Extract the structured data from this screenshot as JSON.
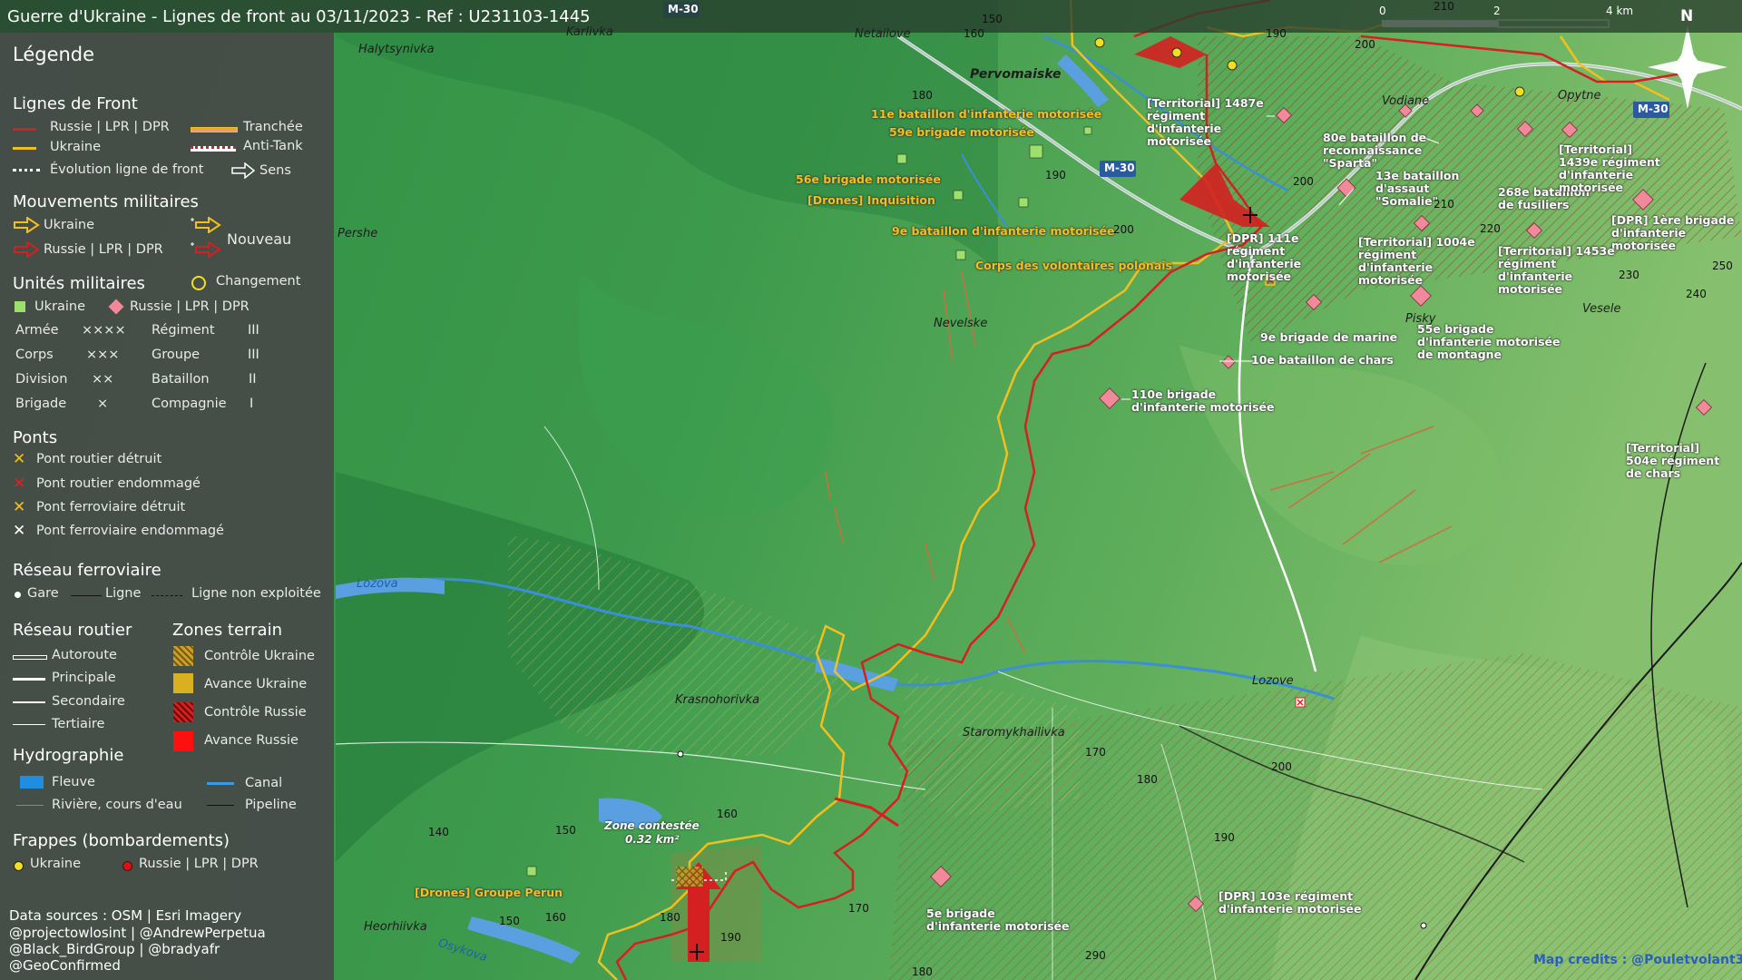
{
  "title": "Guerre d'Ukraine - Lignes de front au 03/11/2023 - Ref : U231103-1445",
  "scale": {
    "label0": "0",
    "label2": "2",
    "label4": "4 km"
  },
  "north": "N",
  "roads": {
    "m30_a": "M-30",
    "m30_b": "M-30",
    "m30_c": "M-30"
  },
  "legend": {
    "title": "Légende",
    "front_lines": {
      "title": "Lignes de Front",
      "russia": "Russie | LPR | DPR",
      "ukraine": "Ukraine",
      "trench": "Tranchée",
      "antitank": "Anti-Tank",
      "evolution": "Évolution ligne de front",
      "direction": "Sens"
    },
    "movements": {
      "title": "Mouvements militaires",
      "ukraine": "Ukraine",
      "russia": "Russie | LPR | DPR",
      "new": "Nouveau"
    },
    "units": {
      "title": "Unités militaires",
      "change": "Changement",
      "ukraine": "Ukraine",
      "russia": "Russie | LPR | DPR",
      "rows": [
        {
          "left": "Armée",
          "left_sym": "××××",
          "right": "Régiment",
          "right_sym": "III"
        },
        {
          "left": "Corps",
          "left_sym": "×××",
          "right": "Groupe",
          "right_sym": "III"
        },
        {
          "left": "Division",
          "left_sym": "××",
          "right": "Bataillon",
          "right_sym": "II"
        },
        {
          "left": "Brigade",
          "left_sym": "×",
          "right": "Compagnie",
          "right_sym": "I"
        }
      ]
    },
    "bridges": {
      "title": "Ponts",
      "items": [
        "Pont routier détruit",
        "Pont routier endommagé",
        "Pont ferroviaire détruit",
        "Pont ferroviaire endommagé"
      ],
      "colors": [
        "#f2c01e",
        "#e02020",
        "#f2c01e",
        "#ffffff"
      ]
    },
    "rail": {
      "title": "Réseau ferroviaire",
      "station": "Gare",
      "line": "Ligne",
      "unused": "Ligne non exploitée"
    },
    "road": {
      "title": "Réseau routier",
      "items": [
        "Autoroute",
        "Principale",
        "Secondaire",
        "Tertiaire"
      ]
    },
    "zones": {
      "title": "Zones terrain",
      "items": [
        "Contrôle Ukraine",
        "Avance Ukraine",
        "Contrôle Russie",
        "Avance Russie"
      ]
    },
    "hydro": {
      "title": "Hydrographie",
      "river_large": "Fleuve",
      "canal": "Canal",
      "river": "Rivière, cours d'eau",
      "pipeline": "Pipeline"
    },
    "strikes": {
      "title": "Frappes (bombardements)",
      "ukraine": "Ukraine",
      "russia": "Russie | LPR | DPR"
    },
    "sources": [
      "Data sources : OSM | Esri Imagery",
      "@projectowlosint | @AndrewPerpetua",
      "@Black_BirdGroup | @bradyafr",
      "@GeoConfirmed"
    ]
  },
  "colors": {
    "russia": "#d42020",
    "ukraine": "#f2c01e",
    "trench": "#e8a060",
    "water": "#3a8fd8",
    "ukraine_unit": "#9ee06e",
    "russia_unit": "#f08a9a"
  },
  "places": {
    "halytsynivka": "Halytsynivka",
    "karlivka": "Karlivka",
    "netailove": "Netailove",
    "pervomaiske": "Pervomaiske",
    "vodiane": "Vodiane",
    "opytne": "Opytne",
    "pershe": "Pershe",
    "nevelske": "Nevelske",
    "pisky": "Pisky",
    "vesele": "Vesele",
    "lozova": "Lozova",
    "krasnohorivka": "Krasnohorivka",
    "staromykhailivka": "Staromykhailivka",
    "lozove": "Lozove",
    "heorhiivka": "Heorhiivka",
    "osykova": "Osykova"
  },
  "units_map": {
    "u11": "11e bataillon d'infanterie motorisée",
    "u59": "59e brigade motorisée",
    "u56": "56e brigade motorisée",
    "udr": "[Drones] Inquisition",
    "u9": "9e bataillon d'infanterie motorisée",
    "upl": "Corps des volontaires polonais",
    "uperun": "[Drones] Groupe Perun",
    "r1487": "[Territorial] 1487e régiment d'infanterie motorisée",
    "r80": "80e bataillon de reconnaissance \"Sparta\"",
    "r13": "13e bataillon d'assaut \"Somalie\"",
    "r268": "268e bataillon de fusiliers",
    "r1439": "[Territorial] 1439e régiment d'infanterie motorisée",
    "r1dpr": "[DPR] 1ère brigade d'infanterie motorisée",
    "r111": "[DPR] 111e régiment d'infanterie motorisée",
    "r1004": "[Territorial] 1004e régiment d'infanterie motorisée",
    "r1453": "[Territorial] 1453e régiment d'infanterie motorisée",
    "r9m": "9e brigade de marine",
    "r55": "55e brigade d'infanterie motorisée de montagne",
    "r10": "10e bataillon de chars",
    "r110": "110e brigade d'infanterie motorisée",
    "r504": "[Territorial] 504e régiment de chars",
    "r5": "5e brigade d'infanterie motorisée",
    "r103": "[DPR] 103e régiment d'infanterie motorisée"
  },
  "zone_contest": {
    "label": "Zone contestée",
    "area": "0.32 km²"
  },
  "contours": [
    "160",
    "150",
    "190",
    "180",
    "200",
    "190",
    "210",
    "200",
    "200",
    "210",
    "220",
    "230",
    "250",
    "240",
    "170",
    "180",
    "200",
    "190",
    "140",
    "150",
    "160",
    "180",
    "190",
    "170",
    "290",
    "180",
    "150",
    "160",
    "180"
  ],
  "map_credits": "Map credits : @Pouletvolant3"
}
